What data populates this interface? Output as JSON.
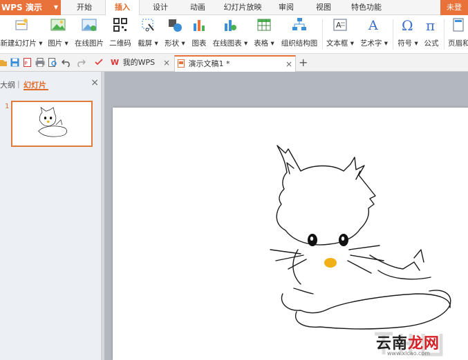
{
  "app": {
    "name": "WPS 演示",
    "login_label": "未登"
  },
  "menu": {
    "tabs": [
      "开始",
      "插入",
      "设计",
      "动画",
      "幻灯片放映",
      "审阅",
      "视图",
      "特色功能"
    ],
    "active": "插入"
  },
  "ribbon": {
    "new_slide": "新建幻灯片",
    "picture": "图片",
    "online_picture": "在线图片",
    "qrcode": "二维码",
    "screenshot": "截屏",
    "shape": "形状",
    "chart": "图表",
    "online_chart": "在线图表",
    "table": "表格",
    "org_chart": "组织结构图",
    "textbox": "文本框",
    "wordart": "艺术字",
    "symbol": "符号",
    "formula": "公式",
    "header": "页眉和"
  },
  "doc_tabs": [
    {
      "label": "我的WPS",
      "close": "×"
    },
    {
      "label": "演示文稿1 *",
      "close": "×"
    }
  ],
  "new_tab_label": "+",
  "left_pane": {
    "outline_label": "大纲",
    "separator": "|",
    "slides_label": "幻灯片",
    "close": "×",
    "slide_number": "1"
  },
  "watermark": {
    "brand_black": "云南",
    "brand_red": "龙网",
    "url": "www.xlcao.com"
  },
  "colors": {
    "accent": "#e8723a",
    "workspace_bg": "#b3b7bf"
  },
  "icons": [
    "new-slide-icon",
    "picture-icon",
    "online-picture-icon",
    "qrcode-icon",
    "screenshot-icon",
    "shape-icon",
    "chart-icon",
    "online-chart-icon",
    "table-icon",
    "org-chart-icon",
    "textbox-icon",
    "wordart-icon",
    "symbol-icon",
    "formula-icon",
    "header-icon"
  ]
}
